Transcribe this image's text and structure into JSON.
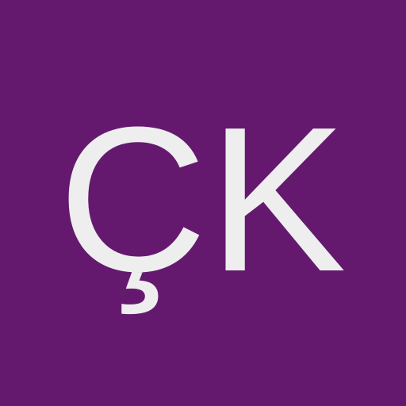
{
  "avatar": {
    "initials": "ÇK",
    "background_color": "#64196f",
    "text_color": "#eeeeee"
  }
}
